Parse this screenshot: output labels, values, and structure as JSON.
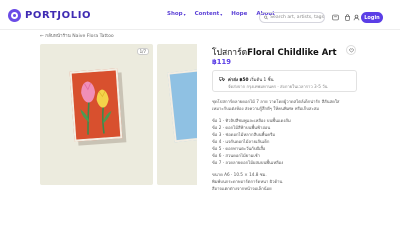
{
  "header": {
    "logo": "PORTJOLIO",
    "nav": [
      {
        "label": "Shop",
        "has_caret": true
      },
      {
        "label": "Content",
        "has_caret": true
      },
      {
        "label": "Hope",
        "has_caret": false
      },
      {
        "label": "About",
        "has_caret": false
      }
    ],
    "search_placeholder": "Search art, artists, tags",
    "login_label": "Login"
  },
  "breadcrumb": "← กลับหน้าร้าน Naive Flora Tattoo",
  "gallery": {
    "counter": "1/7"
  },
  "product": {
    "title_prefix": "โปสการ์ด",
    "title_bold": "Floral Childlike Art",
    "price": "฿119",
    "shipping": {
      "line1_bold": "ค่าส่ง ฿50",
      "line1_rest": " เริ่มต้น 1 ชิ้น",
      "line2": "จัดส่งจาก กรุงเทพมหานคร · ส่งภายในเวลาราว 3-5 วัน"
    },
    "description": [
      "ชุดโปสการ์ดลายดอกไม้ 7 ลาย วาดโดยผู้วาดสไตล์เด็กน่ารัก สีสันสดใส",
      "เหมาะกับแต่งห้อง ส่งความรู้สึกดีๆ ให้คนพิเศษ หรือเก็บสะสม",
      "",
      "ข้อ 1 · ทิวลิปสีชมพูและเหลือง บนพื้นแดงส้ม",
      "ข้อ 2 · ดอกไม้สีฟ้าบนพื้นฟ้าอ่อน",
      "ข้อ 3 · ช่อดอกไม้หลากสีบนพื้นครีม",
      "ข้อ 4 · แจกันดอกไม้ลายเส้นเด็ก",
      "ข้อ 5 · ดอกทานตะวันกับผีเสื้อ",
      "ข้อ 6 · สวนดอกไม้ยามเช้า",
      "ข้อ 7 · ลวดลายดอกไม้ผสมบนพื้นเหลือง",
      "",
      "ขนาด A6 · 10.5 × 14.8 ซม.",
      "พิมพ์บนกระดาษอาร์ตการ์ดหนา ผิวด้าน",
      "สีอาจแตกต่างจากหน้าจอเล็กน้อย"
    ]
  },
  "colors": {
    "brand": "#5b3ee6",
    "logo": "#3f2bb3",
    "card_red": "#d8502e",
    "card_blue": "#8fc1e3"
  },
  "icons": [
    "search-icon",
    "bookmark-icon",
    "bag-icon",
    "user-icon",
    "heart-icon",
    "truck-icon"
  ]
}
